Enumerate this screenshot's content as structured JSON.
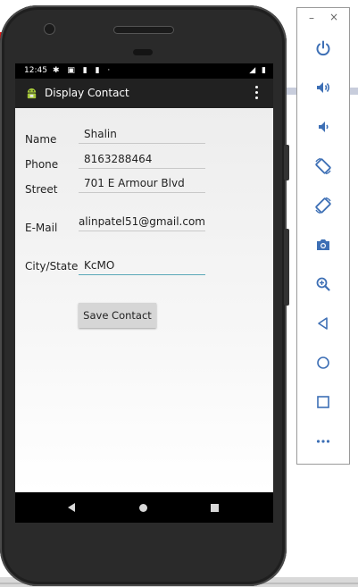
{
  "status_bar": {
    "time": "12:45",
    "icons_left": "✱ ▣ ▮ ▮ ·",
    "icons_right": "◢ ▮"
  },
  "app_bar": {
    "title": "Display Contact",
    "overflow_icon": "overflow-menu-icon"
  },
  "form": {
    "name_label": "Name",
    "name_value": "Shalin",
    "phone_label": "Phone",
    "phone_value": "8163288464",
    "street_label": "Street",
    "street_value": "701 E Armour Blvd",
    "email_label": "E-Mail",
    "email_value": "alinpatel51@gmail.com",
    "city_label": "City/State",
    "city_value": "KcMO",
    "save_label": "Save Contact"
  },
  "nav_bar": {
    "back_icon": "back-icon",
    "home_icon": "home-icon",
    "recent_icon": "recent-apps-icon"
  },
  "emulator_toolbar": {
    "minimize": "–",
    "close": "×",
    "buttons": [
      "power-icon",
      "volume-up-icon",
      "volume-down-icon",
      "rotate-left-icon",
      "rotate-right-icon",
      "camera-icon",
      "zoom-icon",
      "back-icon",
      "home-icon",
      "overview-icon",
      "more-icon"
    ]
  },
  "colors": {
    "accent": "#5aa8b8",
    "toolbar_icon": "#3d6fb5",
    "app_bar": "#212121"
  }
}
